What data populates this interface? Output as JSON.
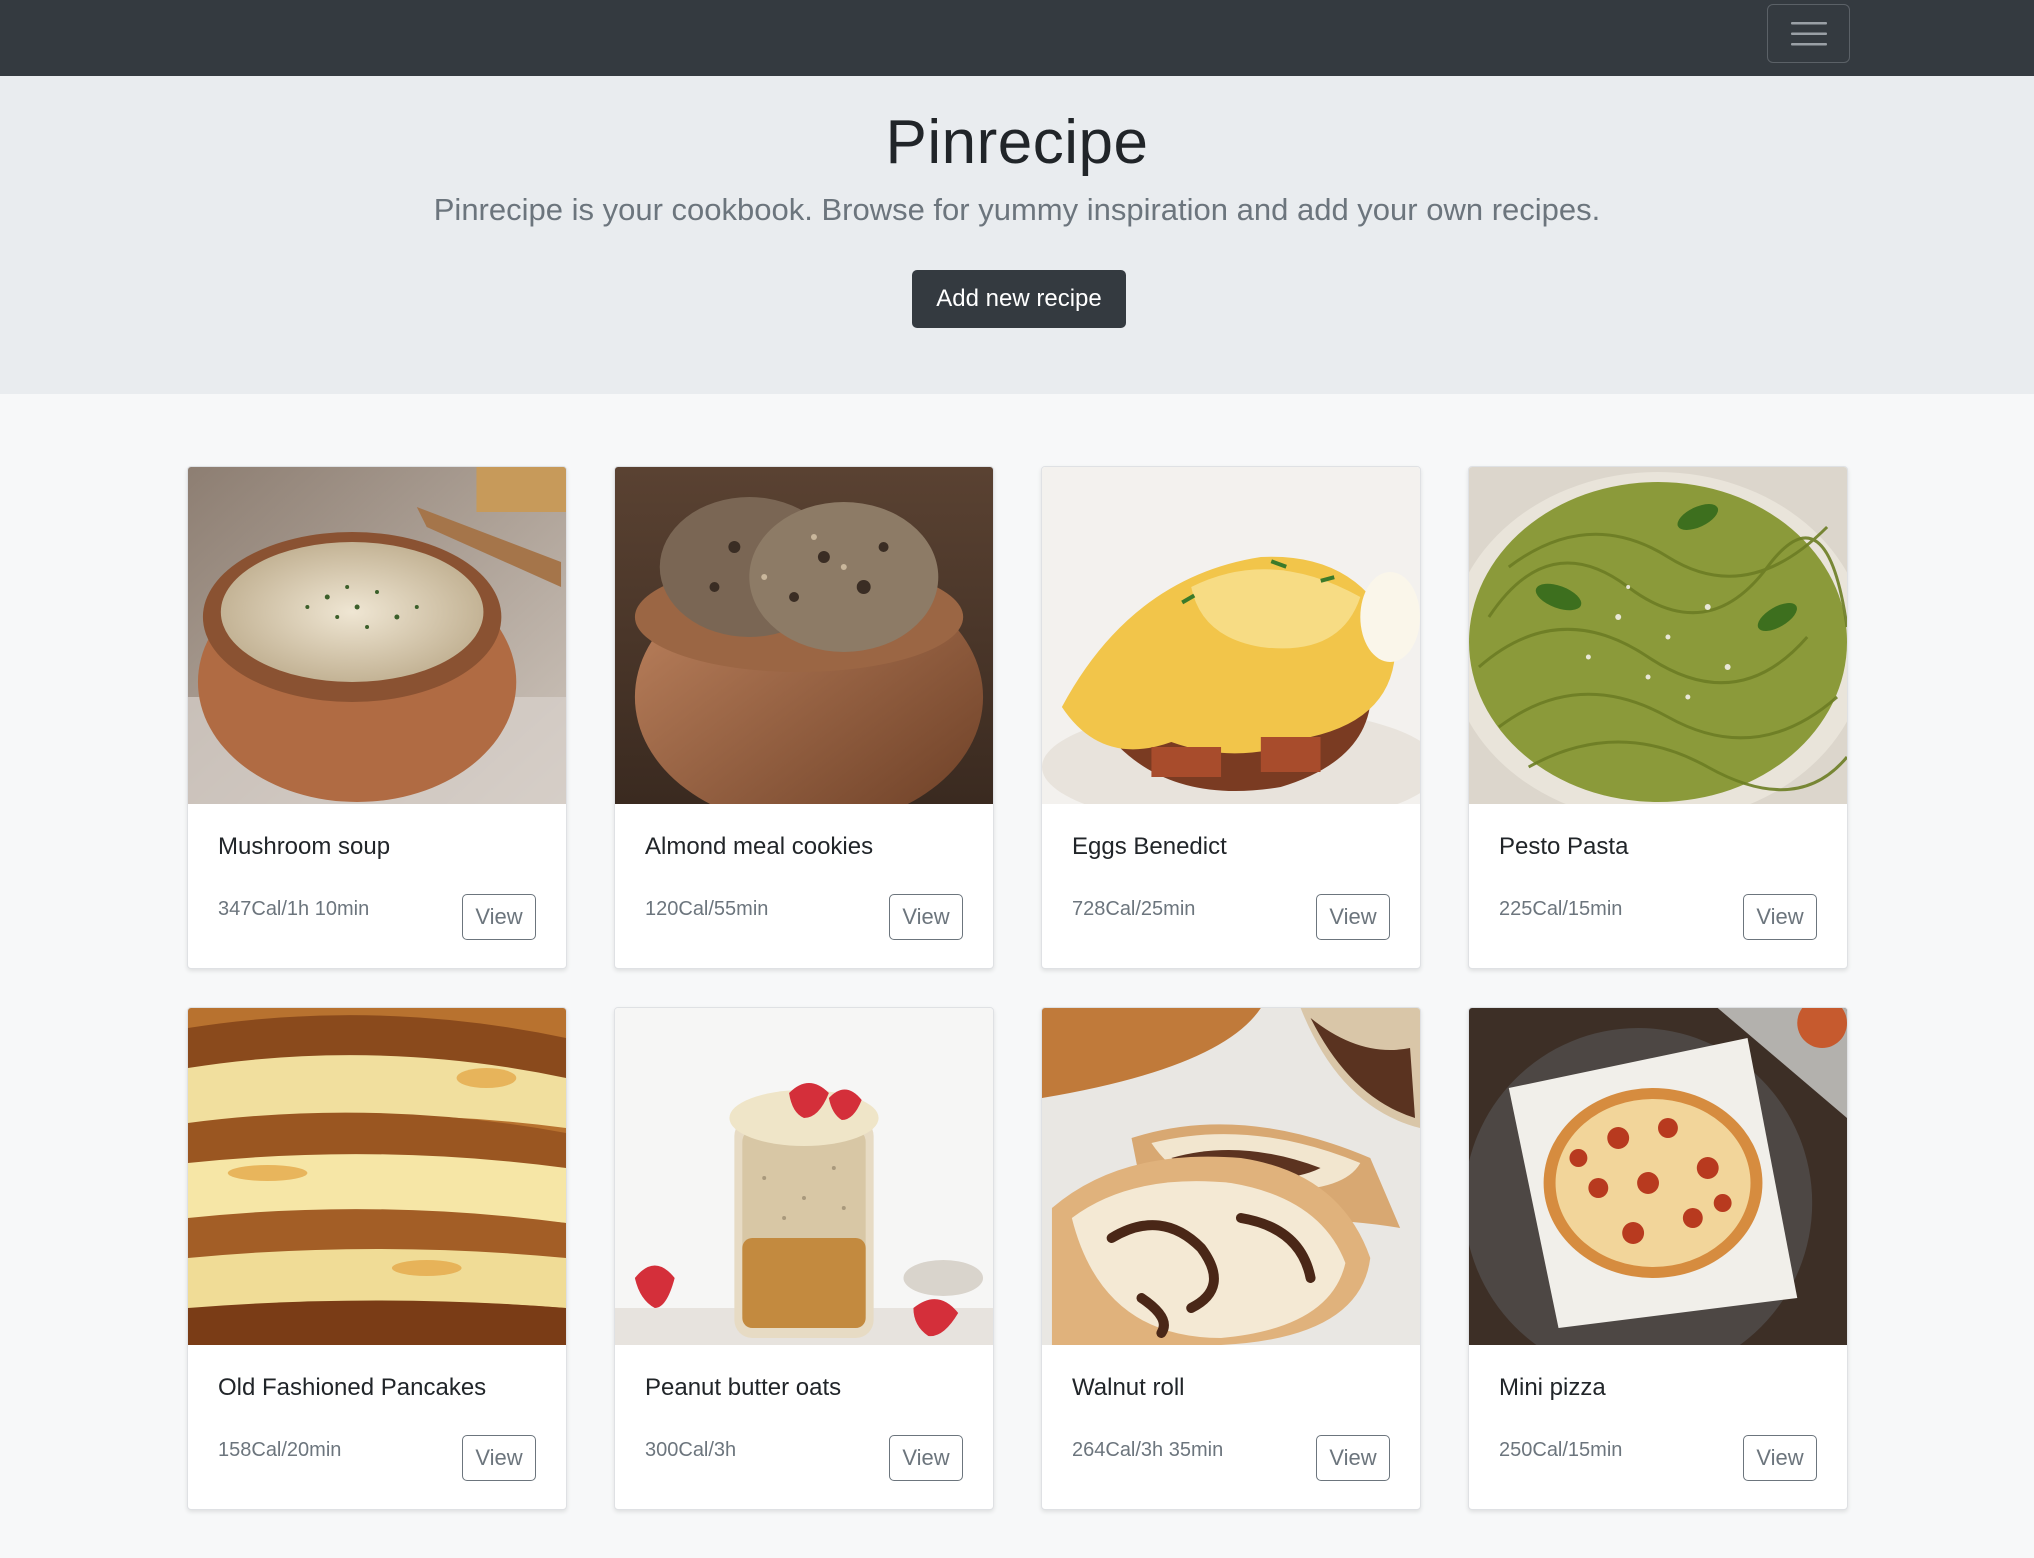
{
  "navbar": {
    "toggler_icon": "hamburger-menu-icon"
  },
  "hero": {
    "title": "Pinrecipe",
    "subtitle": "Pinrecipe is your cookbook. Browse for yummy inspiration and add your own recipes.",
    "add_button_label": "Add new recipe"
  },
  "recipes": [
    {
      "title": "Mushroom soup",
      "meta": "347Cal/1h 10min",
      "view_label": "View"
    },
    {
      "title": "Almond meal cookies",
      "meta": "120Cal/55min",
      "view_label": "View"
    },
    {
      "title": "Eggs Benedict",
      "meta": "728Cal/25min",
      "view_label": "View"
    },
    {
      "title": "Pesto Pasta",
      "meta": "225Cal/15min",
      "view_label": "View"
    },
    {
      "title": "Old Fashioned Pancakes",
      "meta": "158Cal/20min",
      "view_label": "View"
    },
    {
      "title": "Peanut butter oats",
      "meta": "300Cal/3h",
      "view_label": "View"
    },
    {
      "title": "Walnut roll",
      "meta": "264Cal/3h 35min",
      "view_label": "View"
    },
    {
      "title": "Mini pizza",
      "meta": "250Cal/15min",
      "view_label": "View"
    }
  ]
}
